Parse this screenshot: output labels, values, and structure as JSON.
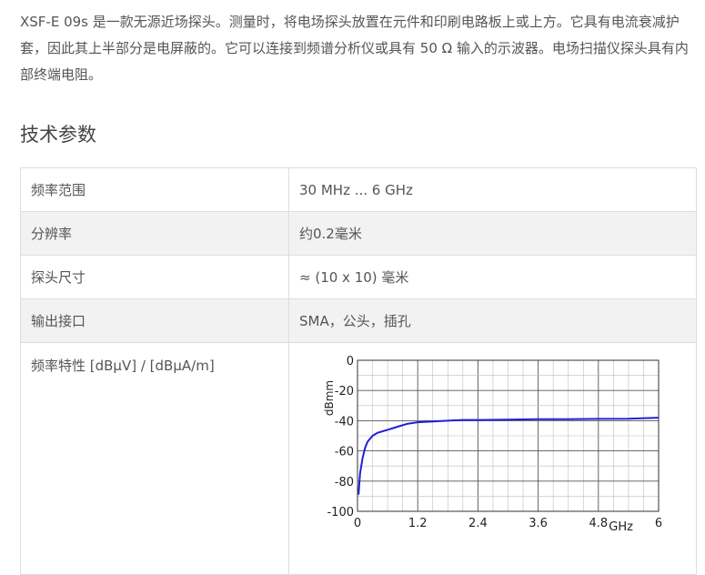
{
  "intro": "XSF-E 09s 是一款无源近场探头。测量时，将电场探头放置在元件和印刷电路板上或上方。它具有电流衰减护套，因此其上半部分是电屏蔽的。它可以连接到频谱分析仪或具有 50 Ω 输入的示波器。电场扫描仪探头具有内部终端电阻。",
  "section_title": "技术参数",
  "specs": [
    {
      "label": "频率范围",
      "value": "30 MHz ... 6 GHz"
    },
    {
      "label": "分辨率",
      "value": "约0.2毫米"
    },
    {
      "label": "探头尺寸",
      "value": "≈ (10 x 10) 毫米"
    },
    {
      "label": "输出接口",
      "value": "SMA，公头，插孔"
    },
    {
      "label": "频率特性 [dBμV] / [dBμA/m]",
      "value": ""
    }
  ],
  "chart_data": {
    "type": "line",
    "xlabel": "GHz",
    "ylabel": "dBmm",
    "xlim": [
      0,
      6
    ],
    "ylim": [
      -100,
      0
    ],
    "x_ticks": [
      "0",
      "1.2",
      "2.4",
      "3.6",
      "4.8",
      "6"
    ],
    "y_ticks": [
      "0",
      "-20",
      "-40",
      "-60",
      "-80",
      "-100"
    ],
    "grid": true,
    "series": [
      {
        "color": "#1f1fd6",
        "x": [
          0.02,
          0.05,
          0.1,
          0.15,
          0.2,
          0.3,
          0.4,
          0.6,
          0.8,
          1.0,
          1.2,
          1.5,
          1.8,
          2.1,
          2.4,
          3.0,
          3.6,
          4.2,
          4.8,
          5.4,
          6.0
        ],
        "y": [
          -89,
          -75,
          -65,
          -58,
          -54,
          -50,
          -48,
          -46,
          -44,
          -42,
          -41,
          -40.5,
          -40,
          -39.5,
          -39.5,
          -39.3,
          -39,
          -39,
          -38.8,
          -38.7,
          -38
        ]
      }
    ]
  }
}
